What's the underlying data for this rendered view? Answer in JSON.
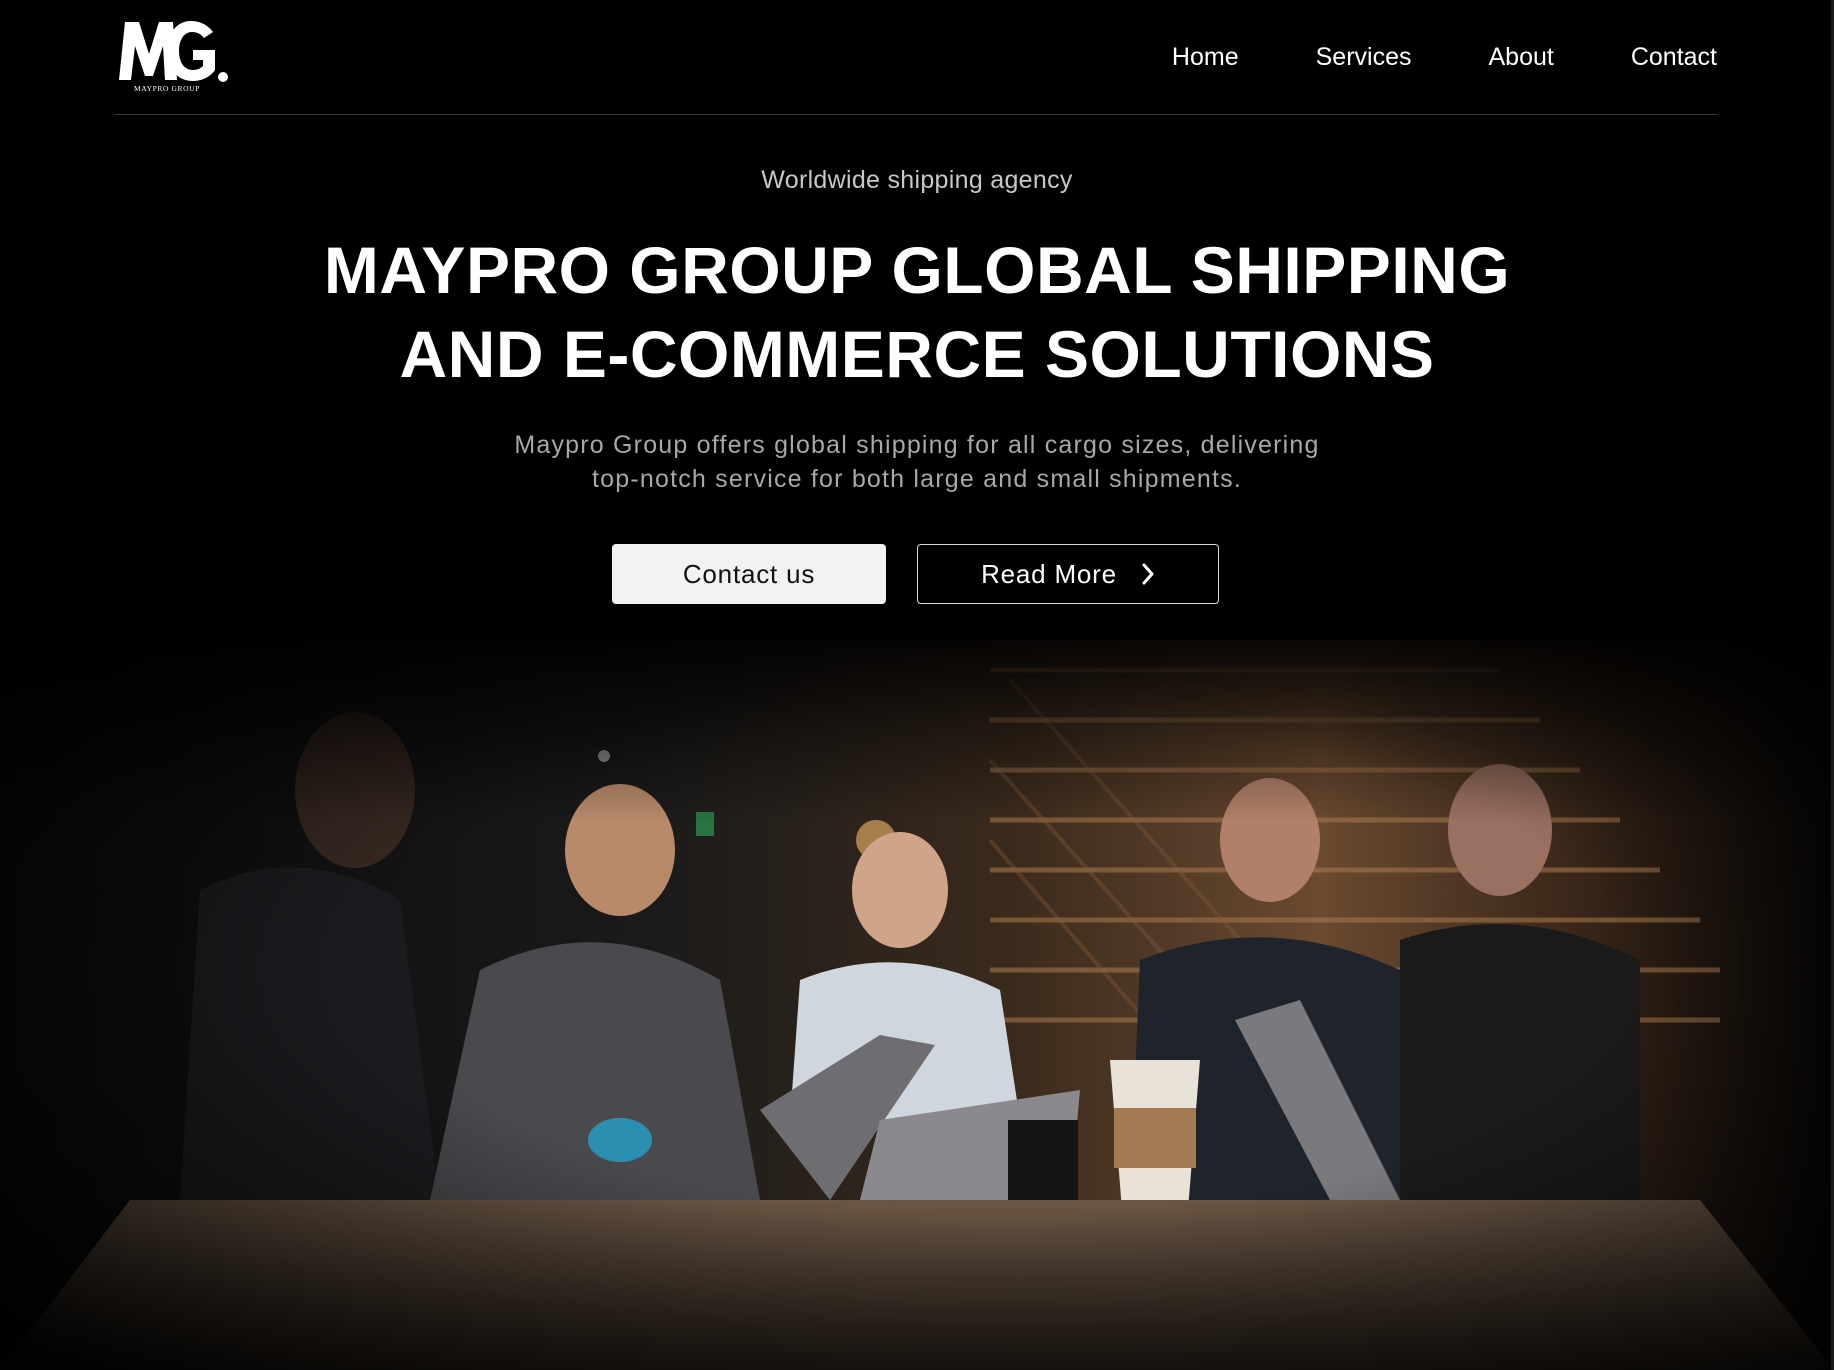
{
  "brand": {
    "logo_mark": "MG.",
    "logo_subtitle": "MAYPRO GROUP"
  },
  "nav": {
    "items": [
      {
        "label": "Home"
      },
      {
        "label": "Services"
      },
      {
        "label": "About"
      },
      {
        "label": "Contact"
      }
    ]
  },
  "hero": {
    "eyebrow": "Worldwide shipping agency",
    "headline_line1": "MAYPRO GROUP GLOBAL SHIPPING",
    "headline_line2": "AND E-COMMERCE SOLUTIONS",
    "subtext_line1": "Maypro Group offers global shipping for all cargo sizes, delivering",
    "subtext_line2": "top-notch service for both large and small shipments.",
    "primary_button": "Contact us",
    "secondary_button": "Read More",
    "secondary_button_icon": "chevron-right-icon"
  },
  "colors": {
    "background": "#000000",
    "text_primary": "#ffffff",
    "text_muted": "#a8a8a8",
    "button_primary_bg": "#f2f2f2"
  }
}
